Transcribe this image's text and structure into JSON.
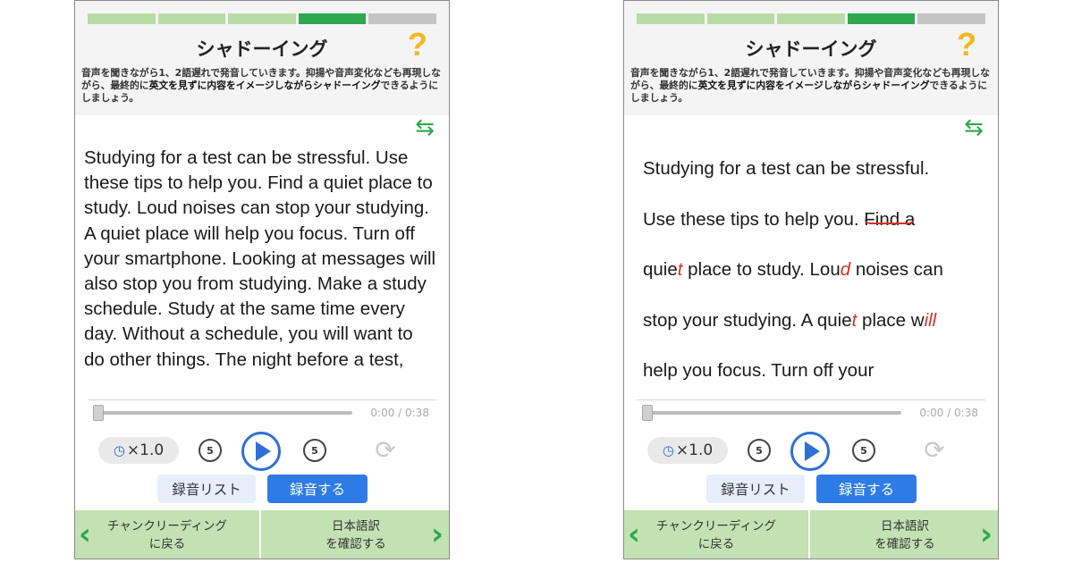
{
  "screens": [
    {
      "progress": [
        "done",
        "done",
        "done",
        "current",
        "todo"
      ],
      "title": "シャドーイング",
      "help_icon": "?",
      "instruction": {
        "p1": "音声を聞きながら1、2語遅れで発音していきます。抑揚や音声変化なども再現しながら、最終的に",
        "em1": "英文を見ずに内容をイメージしながらシャドーイング",
        "p2": "できるようにしましょう。"
      },
      "passage": "Studying for a test can be stressful. Use these tips to help you. Find a quiet place to study. Loud noises can stop your studying. A quiet place will help you focus. Turn off your smartphone. Looking at messages will also stop you from studying. Make a study schedule. Study at the same time every day. Without a schedule, you will want to do other things. The night before a test,",
      "player": {
        "progress_fraction": 0,
        "time": "0:00 / 0:38",
        "speed": "×1.0",
        "skip_back": "5",
        "skip_fwd": "5"
      },
      "buttons": {
        "rec_list": "録音リスト",
        "record": "録音する"
      },
      "nav": {
        "back_line1": "チャンクリーディング",
        "back_line2": "に戻る",
        "next_line1": "日本語訳",
        "next_line2": "を確認する"
      }
    },
    {
      "progress": [
        "done",
        "done",
        "done",
        "current",
        "todo"
      ],
      "title": "シャドーイング",
      "help_icon": "?",
      "instruction": {
        "p1": "音声を聞きながら1、2語遅れで発音していきます。抑揚や音声変化なども再現しながら、最終的に",
        "em1": "英文を見ずに内容をイメージしながらシャドーイング",
        "p2": "できるようにしましょう。"
      },
      "passage_lines": {
        "l1": "Studying for a test can be stressful.",
        "l2a": "Use these tips to help you. ",
        "l2b": "Find a",
        "l3a": "quie",
        "l3b": "t",
        "l3c": " place to study. Lou",
        "l3d": "d",
        "l3e": " noises can",
        "l4a": "stop your studying. A quie",
        "l4b": "t",
        "l4c": " place w",
        "l4d": "ill",
        "l5": "help you focus. Turn off your"
      },
      "player": {
        "progress_fraction": 0,
        "time": "0:00 / 0:38",
        "speed": "×1.0",
        "skip_back": "5",
        "skip_fwd": "5"
      },
      "buttons": {
        "rec_list": "録音リスト",
        "record": "録音する"
      },
      "nav": {
        "back_line1": "チャンクリーディング",
        "back_line2": "に戻る",
        "next_line1": "日本語訳",
        "next_line2": "を確認する"
      }
    }
  ],
  "colors": {
    "accent_green": "#2fa84f",
    "progress_done": "#b9dca6",
    "progress_todo": "#c4c4c4",
    "help_yellow": "#f5b820",
    "play_blue": "#2f6fd6",
    "record_blue": "#2f7be6",
    "nav_green": "#c3e2b3",
    "annotation_red": "#d93025"
  }
}
